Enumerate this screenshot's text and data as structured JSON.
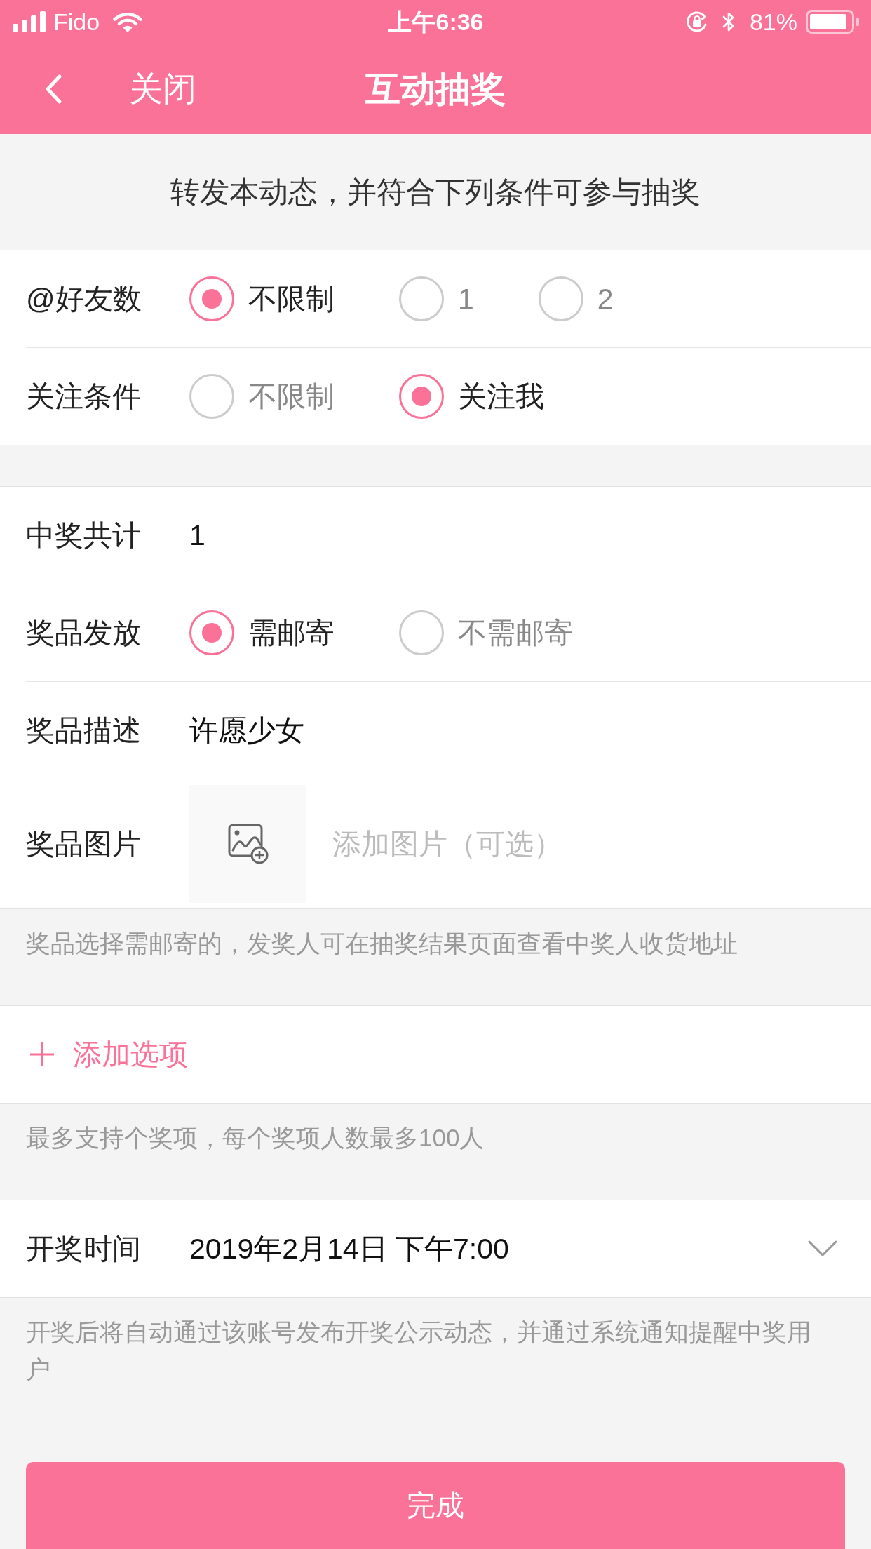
{
  "status_bar": {
    "carrier": "Fido",
    "time": "上午6:36",
    "battery": "81%"
  },
  "nav": {
    "close": "关闭",
    "title": "互动抽奖"
  },
  "intro": "转发本动态，并符合下列条件可参与抽奖",
  "sections": [
    {
      "rows": [
        {
          "kind": "radio",
          "label": "@好友数",
          "options": [
            {
              "label": "不限制",
              "selected": true
            },
            {
              "label": "1",
              "selected": false
            },
            {
              "label": "2",
              "selected": false
            }
          ]
        },
        {
          "kind": "radio",
          "label": "关注条件",
          "options": [
            {
              "label": "不限制",
              "selected": false
            },
            {
              "label": "关注我",
              "selected": true
            }
          ]
        }
      ]
    },
    {
      "rows": [
        {
          "kind": "value",
          "label": "中奖共计",
          "value": "1"
        },
        {
          "kind": "radio",
          "label": "奖品发放",
          "options": [
            {
              "label": "需邮寄",
              "selected": true
            },
            {
              "label": "不需邮寄",
              "selected": false
            }
          ]
        },
        {
          "kind": "value",
          "label": "奖品描述",
          "value": "许愿少女"
        },
        {
          "kind": "image",
          "label": "奖品图片",
          "hint": "添加图片（可选）"
        }
      ],
      "note": "奖品选择需邮寄的，发奖人可在抽奖结果页面查看中奖人收货地址"
    },
    {
      "rows": [
        {
          "kind": "add",
          "label": "添加选项"
        }
      ],
      "note": "最多支持个奖项，每个奖项人数最多100人"
    },
    {
      "rows": [
        {
          "kind": "select",
          "label": "开奖时间",
          "value": "2019年2月14日 下午7:00"
        }
      ],
      "note": "开奖后将自动通过该账号发布开奖公示动态，并通过系统通知提醒中奖用户"
    }
  ],
  "submit": "完成"
}
